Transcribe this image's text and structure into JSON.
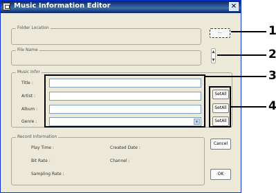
{
  "window": {
    "title": "Music Information Editor",
    "close_glyph": "✕"
  },
  "folder_location": {
    "label": "Folder Location",
    "browse_label": "..."
  },
  "file_name": {
    "label": "File Name"
  },
  "music_info": {
    "label": "Music Infor",
    "fields": [
      {
        "label": "Title :"
      },
      {
        "label": "Artist :"
      },
      {
        "label": "Album :"
      },
      {
        "label": "Genre :"
      }
    ],
    "genre_dropdown_glyph": "▾",
    "setall_labels": [
      "SetAll",
      "SetAll",
      "SetAll"
    ]
  },
  "record_info": {
    "label": "Record Information",
    "play_time": "Play Time :",
    "created_date": "Created Date :",
    "bit_rate": "Bit Rate :",
    "channel": "Channel :",
    "sampling_rate": "Sampling Rate :"
  },
  "buttons": {
    "cancel": "Cancel",
    "ok": "OK"
  },
  "callouts": [
    "1",
    "2",
    "3",
    "4"
  ]
}
